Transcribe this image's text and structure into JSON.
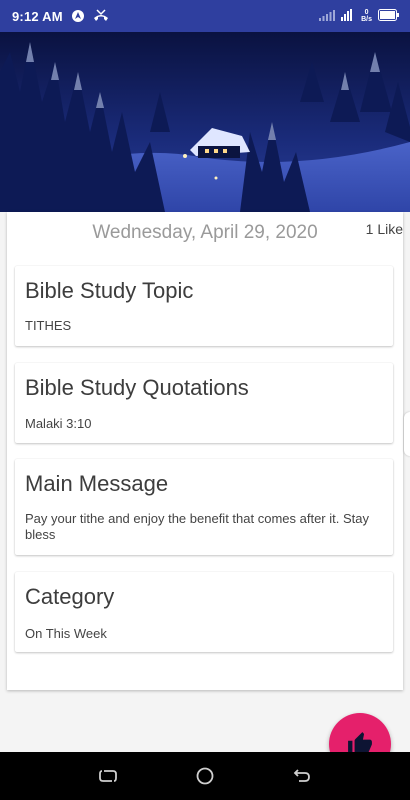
{
  "status_bar": {
    "time": "9:12 AM",
    "net_speed_value": "0",
    "net_speed_unit": "B/s",
    "icons": [
      "navigation-icon",
      "missed-call-icon",
      "signal-icon",
      "wifi-icon",
      "battery-icon"
    ]
  },
  "hero": {
    "image": "snowy-cabin-forest-night"
  },
  "post": {
    "date": "Wednesday, April 29, 2020",
    "likes": "1 Like",
    "sections": [
      {
        "title": "Bible Study Topic",
        "body": "TITHES"
      },
      {
        "title": "Bible Study Quotations",
        "body": "Malaki 3:10"
      },
      {
        "title": "Main Message",
        "body": "Pay your tithe and enjoy the benefit that comes after it. Stay bless"
      },
      {
        "title": "Category",
        "body": "On This Week"
      }
    ]
  },
  "fab": {
    "icon": "thumbs-up-icon",
    "color": "#e5206b"
  },
  "nav_bar": {
    "buttons": [
      "recents-button",
      "home-button",
      "back-button"
    ]
  },
  "colors": {
    "status_bar": "#2f3f9f",
    "accent": "#e5206b",
    "background": "#f4f4f4"
  }
}
